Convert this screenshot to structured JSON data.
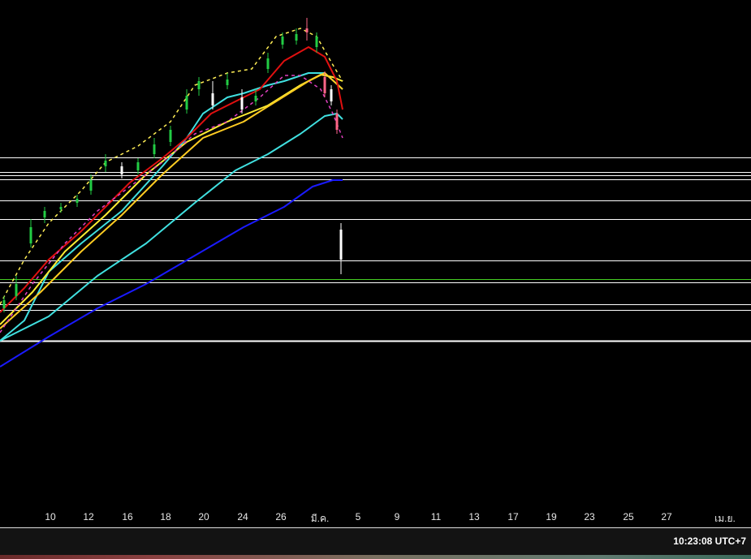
{
  "chart_data": {
    "type": "line",
    "title": "",
    "xlabel": "",
    "ylabel": "",
    "xlim": [
      0,
      92.5
    ],
    "ylim": [
      0,
      62
    ],
    "grid": false,
    "x_ticks": [
      {
        "label": "10",
        "x": 6.2
      },
      {
        "label": "12",
        "x": 10.9
      },
      {
        "label": "16",
        "x": 15.7
      },
      {
        "label": "18",
        "x": 20.4
      },
      {
        "label": "20",
        "x": 25.1
      },
      {
        "label": "24",
        "x": 29.9
      },
      {
        "label": "26",
        "x": 34.6
      },
      {
        "label": "มี.ค.",
        "x": 39.4
      },
      {
        "label": "5",
        "x": 44.1
      },
      {
        "label": "9",
        "x": 48.9
      },
      {
        "label": "11",
        "x": 53.7
      },
      {
        "label": "13",
        "x": 58.4
      },
      {
        "label": "17",
        "x": 63.2
      },
      {
        "label": "19",
        "x": 67.9
      },
      {
        "label": "23",
        "x": 72.6
      },
      {
        "label": "25",
        "x": 77.4
      },
      {
        "label": "27",
        "x": 82.1
      },
      {
        "label": "เม.ย.",
        "x": 89.3
      }
    ],
    "horizontal_levels": [
      {
        "value": 42.6,
        "color": "#ffffff"
      },
      {
        "value": 40.8,
        "color": "#ffffff"
      },
      {
        "value": 40.4,
        "color": "#ffffff"
      },
      {
        "value": 39.9,
        "color": "#ffffff"
      },
      {
        "value": 37.3,
        "color": "#ffffff"
      },
      {
        "value": 35.0,
        "color": "#ffffff"
      },
      {
        "value": 29.9,
        "color": "#ffffff"
      },
      {
        "value": 27.6,
        "color": "#44cc22"
      },
      {
        "value": 27.2,
        "color": "#ffffff"
      },
      {
        "value": 24.5,
        "color": "#ffffff"
      },
      {
        "value": 23.8,
        "color": "#ffffff"
      },
      {
        "value": 20.0,
        "color": "#ffffff"
      }
    ],
    "series": [
      {
        "name": "blue-ma",
        "color": "#1a1aff",
        "dash": false,
        "points": [
          [
            0,
            16.8
          ],
          [
            6,
            20.5
          ],
          [
            12,
            24
          ],
          [
            18,
            27
          ],
          [
            24,
            30.5
          ],
          [
            30,
            34
          ],
          [
            35,
            36.5
          ],
          [
            38.5,
            39
          ],
          [
            41,
            39.8
          ],
          [
            42.2,
            39.8
          ]
        ]
      },
      {
        "name": "cyan-slow",
        "color": "#40e0e0",
        "dash": false,
        "points": [
          [
            0,
            20
          ],
          [
            6,
            23
          ],
          [
            12,
            28
          ],
          [
            18,
            32
          ],
          [
            24,
            37
          ],
          [
            29,
            41
          ],
          [
            33,
            43
          ],
          [
            37,
            45.5
          ],
          [
            40,
            47.7
          ],
          [
            41.5,
            48
          ],
          [
            42.2,
            47.3
          ]
        ]
      },
      {
        "name": "cyan-fast",
        "color": "#40e0e0",
        "dash": false,
        "points": [
          [
            0,
            20
          ],
          [
            3,
            22.5
          ],
          [
            6,
            28.5
          ],
          [
            10,
            32
          ],
          [
            15,
            36
          ],
          [
            20,
            41.5
          ],
          [
            23,
            45
          ],
          [
            25,
            48
          ],
          [
            28,
            50
          ],
          [
            30,
            50.5
          ],
          [
            33,
            51.5
          ],
          [
            35,
            52
          ],
          [
            38,
            53
          ],
          [
            40,
            53
          ],
          [
            42.2,
            51
          ]
        ]
      },
      {
        "name": "yellow-1",
        "color": "#ffee33",
        "dash": false,
        "points": [
          [
            0,
            22
          ],
          [
            4,
            26
          ],
          [
            8,
            31
          ],
          [
            13,
            35.5
          ],
          [
            18,
            40.5
          ],
          [
            23,
            44.5
          ],
          [
            28,
            47
          ],
          [
            33,
            49
          ],
          [
            37,
            51.5
          ],
          [
            39.5,
            52.8
          ],
          [
            41,
            52.5
          ],
          [
            42.2,
            52
          ]
        ]
      },
      {
        "name": "yellow-2",
        "color": "#ffcc22",
        "dash": false,
        "points": [
          [
            0,
            21.5
          ],
          [
            5,
            26
          ],
          [
            10,
            31
          ],
          [
            15,
            35.5
          ],
          [
            20,
            40.5
          ],
          [
            25,
            45
          ],
          [
            30,
            47
          ],
          [
            34,
            49.5
          ],
          [
            38,
            52
          ],
          [
            40,
            53
          ],
          [
            42.2,
            51
          ]
        ]
      },
      {
        "name": "red-ma",
        "color": "#e01010",
        "dash": false,
        "points": [
          [
            0,
            23.5
          ],
          [
            3,
            26.5
          ],
          [
            6,
            30
          ],
          [
            10,
            33.5
          ],
          [
            13,
            36.5
          ],
          [
            16,
            39.5
          ],
          [
            20,
            42.5
          ],
          [
            23,
            45
          ],
          [
            26,
            48
          ],
          [
            29,
            49.5
          ],
          [
            32,
            51
          ],
          [
            35,
            54.5
          ],
          [
            38,
            56.2
          ],
          [
            40,
            55
          ],
          [
            41.5,
            52
          ],
          [
            42.2,
            48.5
          ]
        ]
      },
      {
        "name": "upper-band",
        "color": "#ffee55",
        "dash": true,
        "points": [
          [
            0,
            24.5
          ],
          [
            3,
            30
          ],
          [
            6,
            34.5
          ],
          [
            10,
            38.5
          ],
          [
            13,
            42
          ],
          [
            17,
            44
          ],
          [
            21,
            47
          ],
          [
            24,
            51.5
          ],
          [
            28,
            53
          ],
          [
            31,
            53.5
          ],
          [
            34,
            57.5
          ],
          [
            37,
            58.5
          ],
          [
            39,
            57.5
          ],
          [
            41,
            54
          ],
          [
            42.2,
            52
          ]
        ]
      },
      {
        "name": "lower-band",
        "color": "#e040c0",
        "dash": true,
        "points": [
          [
            0,
            21
          ],
          [
            4,
            27
          ],
          [
            8,
            32
          ],
          [
            12,
            36
          ],
          [
            16,
            39
          ],
          [
            20,
            42
          ],
          [
            24,
            45.5
          ],
          [
            28,
            47
          ],
          [
            32,
            50
          ],
          [
            35,
            52.7
          ],
          [
            37,
            52.7
          ],
          [
            39.5,
            51
          ],
          [
            41,
            48
          ],
          [
            42.2,
            45
          ]
        ]
      }
    ],
    "candles": [
      {
        "x": 0.5,
        "o": 24,
        "c": 25,
        "h": 25.5,
        "l": 23.5
      },
      {
        "x": 2,
        "o": 25.5,
        "c": 27,
        "h": 28,
        "l": 25
      },
      {
        "x": 3.8,
        "o": 32,
        "c": 34,
        "h": 35,
        "l": 31.5
      },
      {
        "x": 5.5,
        "o": 35.2,
        "c": 36,
        "h": 36.5,
        "l": 34.5
      },
      {
        "x": 7.5,
        "o": 36.2,
        "c": 36.5,
        "h": 37,
        "l": 35.8
      },
      {
        "x": 9.5,
        "o": 37,
        "c": 37.5,
        "h": 38,
        "l": 36.5
      },
      {
        "x": 11.2,
        "o": 38.5,
        "c": 39.8,
        "h": 40.5,
        "l": 38
      },
      {
        "x": 13,
        "o": 41.5,
        "c": 42.2,
        "h": 43,
        "l": 40.8
      },
      {
        "x": 15,
        "o": 41.5,
        "c": 40.5,
        "h": 42,
        "l": 40
      },
      {
        "x": 17,
        "o": 41,
        "c": 42,
        "h": 42.5,
        "l": 40.5
      },
      {
        "x": 19,
        "o": 43,
        "c": 44.2,
        "h": 45,
        "l": 42.5
      },
      {
        "x": 21,
        "o": 44.5,
        "c": 46,
        "h": 46.5,
        "l": 44
      },
      {
        "x": 23,
        "o": 48.5,
        "c": 50.2,
        "h": 51,
        "l": 48
      },
      {
        "x": 24.5,
        "o": 51,
        "c": 52,
        "h": 52.5,
        "l": 50.2
      },
      {
        "x": 26.2,
        "o": 50.5,
        "c": 49,
        "h": 52,
        "l": 48.5
      },
      {
        "x": 28,
        "o": 51.5,
        "c": 52.2,
        "h": 53,
        "l": 51
      },
      {
        "x": 29.8,
        "o": 50,
        "c": 48.5,
        "h": 51,
        "l": 48
      },
      {
        "x": 31.5,
        "o": 49.5,
        "c": 50.2,
        "h": 51,
        "l": 49
      },
      {
        "x": 33,
        "o": 53.5,
        "c": 54.8,
        "h": 55.5,
        "l": 53
      },
      {
        "x": 34.8,
        "o": 56.5,
        "c": 57.5,
        "h": 58,
        "l": 56
      },
      {
        "x": 36.5,
        "o": 57,
        "c": 57.8,
        "h": 58.5,
        "l": 56.5
      },
      {
        "x": 37.8,
        "o": 58.5,
        "c": 58,
        "h": 59.8,
        "l": 57
      },
      {
        "x": 39,
        "o": 56.2,
        "c": 57.5,
        "h": 58,
        "l": 55.5
      },
      {
        "x": 40,
        "o": 52.5,
        "c": 50.5,
        "h": 53.2,
        "l": 50
      },
      {
        "x": 40.8,
        "o": 51,
        "c": 49.5,
        "h": 51.5,
        "l": 49
      },
      {
        "x": 41.5,
        "o": 48,
        "c": 46,
        "h": 48.5,
        "l": 45.5
      },
      {
        "x": 42,
        "o": 33.7,
        "c": 30,
        "h": 34.5,
        "l": 28.2
      }
    ],
    "colors": {
      "up": "#22cc44",
      "down": "#ffffff",
      "down_accent": "#ff6688"
    }
  },
  "status_bar": {
    "clock": "10:23:08 UTC+7"
  }
}
